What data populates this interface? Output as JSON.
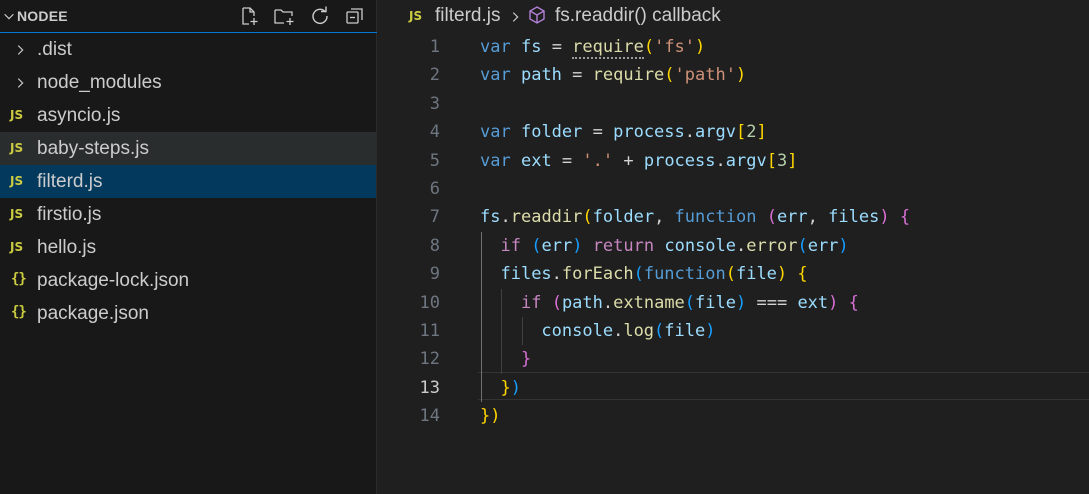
{
  "explorer": {
    "title": "NODEE",
    "actions": [
      "new-file",
      "new-folder",
      "refresh",
      "collapse-all"
    ],
    "items": [
      {
        "label": ".dist",
        "kind": "folder"
      },
      {
        "label": "node_modules",
        "kind": "folder"
      },
      {
        "label": "asyncio.js",
        "kind": "js",
        "icon_text": "JS"
      },
      {
        "label": "baby-steps.js",
        "kind": "js",
        "icon_text": "JS",
        "state": "hover"
      },
      {
        "label": "filterd.js",
        "kind": "js",
        "icon_text": "JS",
        "state": "selected"
      },
      {
        "label": "firstio.js",
        "kind": "js",
        "icon_text": "JS"
      },
      {
        "label": "hello.js",
        "kind": "js",
        "icon_text": "JS"
      },
      {
        "label": "package-lock.json",
        "kind": "json",
        "icon_text": "{}"
      },
      {
        "label": "package.json",
        "kind": "json",
        "icon_text": "{}"
      }
    ]
  },
  "breadcrumb": {
    "file_icon_text": "JS",
    "file": "filterd.js",
    "symbol": "fs.readdir() callback"
  },
  "editor": {
    "active_line": 13,
    "lines": [
      {
        "n": "1",
        "tokens": [
          [
            "kw",
            "var"
          ],
          [
            "op",
            " "
          ],
          [
            "vr",
            "fs"
          ],
          [
            "op",
            " = "
          ],
          [
            "fn",
            "require",
            "dotted"
          ],
          [
            "b1",
            "("
          ],
          [
            "st",
            "'fs'"
          ],
          [
            "b1",
            ")"
          ]
        ]
      },
      {
        "n": "2",
        "tokens": [
          [
            "kw",
            "var"
          ],
          [
            "op",
            " "
          ],
          [
            "vr",
            "path"
          ],
          [
            "op",
            " = "
          ],
          [
            "fn",
            "require"
          ],
          [
            "b1",
            "("
          ],
          [
            "st",
            "'path'"
          ],
          [
            "b1",
            ")"
          ]
        ]
      },
      {
        "n": "3",
        "tokens": []
      },
      {
        "n": "4",
        "tokens": [
          [
            "kw",
            "var"
          ],
          [
            "op",
            " "
          ],
          [
            "vr",
            "folder"
          ],
          [
            "op",
            " = "
          ],
          [
            "vr",
            "process"
          ],
          [
            "op",
            "."
          ],
          [
            "vr",
            "argv"
          ],
          [
            "b1",
            "["
          ],
          [
            "nm",
            "2"
          ],
          [
            "b1",
            "]"
          ]
        ]
      },
      {
        "n": "5",
        "tokens": [
          [
            "kw",
            "var"
          ],
          [
            "op",
            " "
          ],
          [
            "vr",
            "ext"
          ],
          [
            "op",
            " = "
          ],
          [
            "st",
            "'.'"
          ],
          [
            "op",
            " + "
          ],
          [
            "vr",
            "process"
          ],
          [
            "op",
            "."
          ],
          [
            "vr",
            "argv"
          ],
          [
            "b1",
            "["
          ],
          [
            "nm",
            "3"
          ],
          [
            "b1",
            "]"
          ]
        ]
      },
      {
        "n": "6",
        "tokens": []
      },
      {
        "n": "7",
        "tokens": [
          [
            "vr",
            "fs"
          ],
          [
            "op",
            "."
          ],
          [
            "fn",
            "readdir"
          ],
          [
            "b1",
            "("
          ],
          [
            "vr",
            "folder"
          ],
          [
            "op",
            ", "
          ],
          [
            "kw",
            "function"
          ],
          [
            "op",
            " "
          ],
          [
            "b2",
            "("
          ],
          [
            "vr",
            "err"
          ],
          [
            "op",
            ", "
          ],
          [
            "vr",
            "files"
          ],
          [
            "b2",
            ")"
          ],
          [
            "op",
            " "
          ],
          [
            "b2",
            "{"
          ]
        ]
      },
      {
        "n": "8",
        "tokens": [
          [
            "op",
            "  "
          ],
          [
            "ctl",
            "if"
          ],
          [
            "op",
            " "
          ],
          [
            "b3",
            "("
          ],
          [
            "vr",
            "err"
          ],
          [
            "b3",
            ")"
          ],
          [
            "op",
            " "
          ],
          [
            "ctl",
            "return"
          ],
          [
            "op",
            " "
          ],
          [
            "vr",
            "console"
          ],
          [
            "op",
            "."
          ],
          [
            "fn",
            "error"
          ],
          [
            "b3",
            "("
          ],
          [
            "vr",
            "err"
          ],
          [
            "b3",
            ")"
          ]
        ]
      },
      {
        "n": "9",
        "tokens": [
          [
            "op",
            "  "
          ],
          [
            "vr",
            "files"
          ],
          [
            "op",
            "."
          ],
          [
            "fn",
            "forEach"
          ],
          [
            "b3",
            "("
          ],
          [
            "kw",
            "function"
          ],
          [
            "b1",
            "("
          ],
          [
            "vr",
            "file"
          ],
          [
            "b1",
            ")"
          ],
          [
            "op",
            " "
          ],
          [
            "b1",
            "{"
          ]
        ]
      },
      {
        "n": "10",
        "tokens": [
          [
            "op",
            "    "
          ],
          [
            "ctl",
            "if"
          ],
          [
            "op",
            " "
          ],
          [
            "b2",
            "("
          ],
          [
            "vr",
            "path"
          ],
          [
            "op",
            "."
          ],
          [
            "fn",
            "extname"
          ],
          [
            "b3",
            "("
          ],
          [
            "vr",
            "file"
          ],
          [
            "b3",
            ")"
          ],
          [
            "op",
            " === "
          ],
          [
            "vr",
            "ext"
          ],
          [
            "b2",
            ")"
          ],
          [
            "op",
            " "
          ],
          [
            "b2",
            "{"
          ]
        ]
      },
      {
        "n": "11",
        "tokens": [
          [
            "op",
            "      "
          ],
          [
            "vr",
            "console"
          ],
          [
            "op",
            "."
          ],
          [
            "fn",
            "log"
          ],
          [
            "b3",
            "("
          ],
          [
            "vr",
            "file"
          ],
          [
            "b3",
            ")"
          ]
        ]
      },
      {
        "n": "12",
        "tokens": [
          [
            "op",
            "    "
          ],
          [
            "b2",
            "}"
          ]
        ]
      },
      {
        "n": "13",
        "tokens": [
          [
            "op",
            "  "
          ],
          [
            "b1",
            "}"
          ],
          [
            "b3",
            ")"
          ]
        ]
      },
      {
        "n": "14",
        "tokens": [
          [
            "b1",
            "}"
          ],
          [
            "b1",
            ")"
          ]
        ]
      }
    ]
  }
}
